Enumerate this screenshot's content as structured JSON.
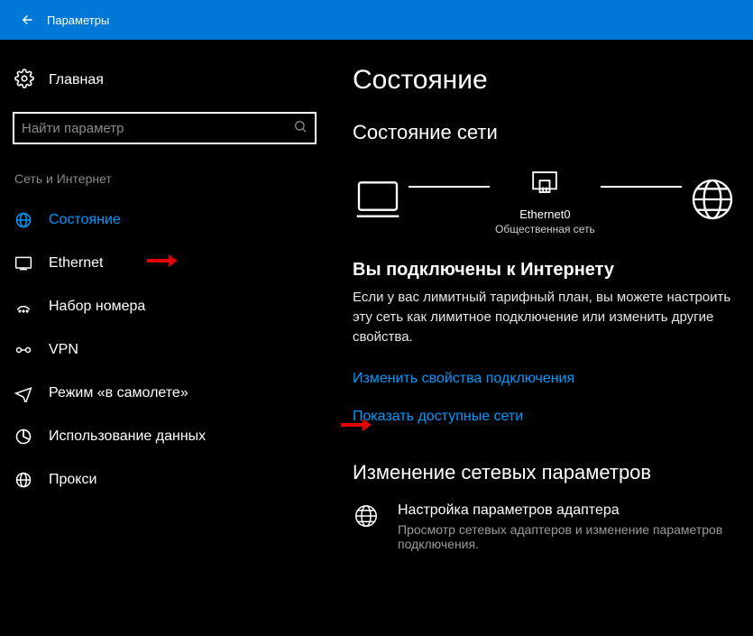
{
  "titlebar": {
    "title": "Параметры"
  },
  "home": {
    "label": "Главная"
  },
  "search": {
    "placeholder": "Найти параметр"
  },
  "sidebar": {
    "section_title": "Сеть и Интернет",
    "items": [
      {
        "label": "Состояние",
        "icon": "status-icon",
        "selected": true
      },
      {
        "label": "Ethernet",
        "icon": "ethernet-icon",
        "selected": false
      },
      {
        "label": "Набор номера",
        "icon": "dialup-icon",
        "selected": false
      },
      {
        "label": "VPN",
        "icon": "vpn-icon",
        "selected": false
      },
      {
        "label": "Режим «в самолете»",
        "icon": "airplane-icon",
        "selected": false
      },
      {
        "label": "Использование данных",
        "icon": "datausage-icon",
        "selected": false
      },
      {
        "label": "Прокси",
        "icon": "proxy-icon",
        "selected": false
      }
    ]
  },
  "main": {
    "page_title": "Состояние",
    "network_status_title": "Состояние сети",
    "connection_name": "Ethernet0",
    "connection_profile": "Общественная сеть",
    "connected_heading": "Вы подключены к Интернету",
    "connected_body": "Если у вас лимитный тарифный план, вы можете настроить эту сеть как лимитное подключение или изменить другие свойства.",
    "link_change_properties": "Изменить свойства подключения",
    "link_show_networks": "Показать доступные сети",
    "change_settings_title": "Изменение сетевых параметров",
    "adapter": {
      "title": "Настройка параметров адаптера",
      "desc": "Просмотр сетевых адаптеров и изменение параметров подключения."
    }
  }
}
